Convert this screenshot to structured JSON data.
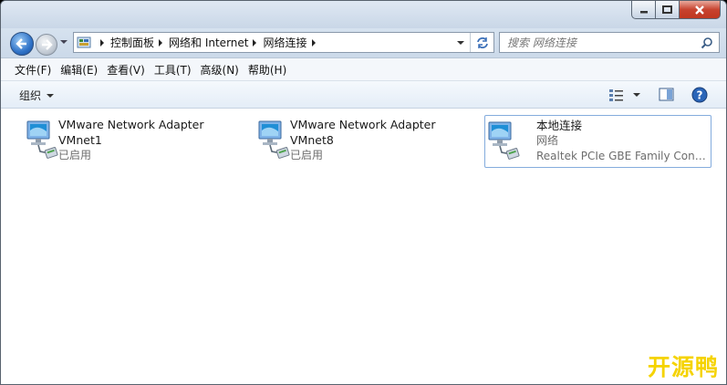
{
  "window": {
    "caption_buttons": [
      "minimize",
      "maximize",
      "close"
    ]
  },
  "navigation": {
    "breadcrumbs": [
      "控制面板",
      "网络和 Internet",
      "网络连接"
    ],
    "search_placeholder": "搜索 网络连接"
  },
  "menubar": {
    "items": [
      "文件(F)",
      "编辑(E)",
      "查看(V)",
      "工具(T)",
      "高级(N)",
      "帮助(H)"
    ]
  },
  "commandbar": {
    "organize_label": "组织"
  },
  "adapters": [
    {
      "name": "VMware Network Adapter",
      "subtitle": "VMnet1",
      "status": "已启用"
    },
    {
      "name": "VMware Network Adapter",
      "subtitle": "VMnet8",
      "status": "已启用"
    },
    {
      "name": "本地连接",
      "subtitle": "网络",
      "status": "Realtek PCIe GBE Family Controller"
    }
  ],
  "watermark": "开源鸭",
  "colors": {
    "accent_blue": "#2f72c7",
    "close_red": "#c7432f",
    "watermark_yellow": "#f5d300",
    "selection_border": "#84acdd"
  }
}
